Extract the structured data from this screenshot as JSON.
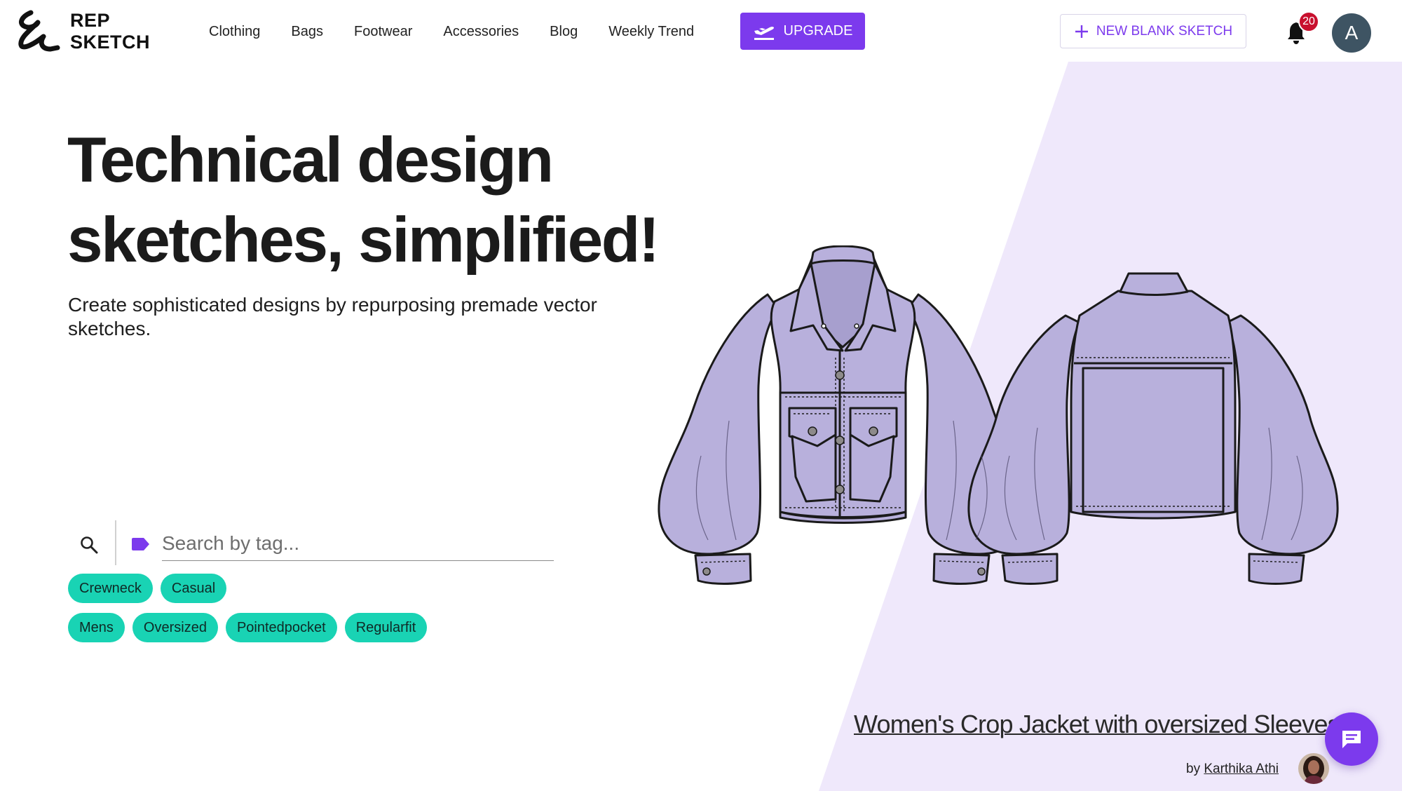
{
  "brand": {
    "line1": "REP",
    "line2": "SKETCH"
  },
  "nav": [
    "Clothing",
    "Bags",
    "Footwear",
    "Accessories",
    "Blog",
    "Weekly Trend"
  ],
  "upgrade_label": "UPGRADE",
  "new_sketch_label": "NEW BLANK SKETCH",
  "notifications_count": "20",
  "avatar_initial": "A",
  "hero": {
    "title": "Technical design sketches, simplified!",
    "subtitle": "Create sophisticated designs by repurposing premade vector sketches."
  },
  "search": {
    "placeholder": "Search by tag..."
  },
  "tags": {
    "row1": [
      "Crewneck",
      "Casual"
    ],
    "row2": [
      "Mens",
      "Oversized",
      "Pointedpocket",
      "Regularfit"
    ]
  },
  "featured": {
    "title": "Women's Crop Jacket with oversized Sleeves",
    "by_prefix": "by",
    "author": "Karthika Athi"
  },
  "colors": {
    "accent": "#7c3aed",
    "chip": "#19d3b4",
    "panel": "#efe8fb",
    "garment": "#b8b0dc",
    "badge": "#c8102e"
  },
  "icons": [
    "logo-mark",
    "upgrade-plane-icon",
    "plus-icon",
    "bell-icon",
    "search-icon",
    "tag-icon",
    "chat-icon"
  ]
}
